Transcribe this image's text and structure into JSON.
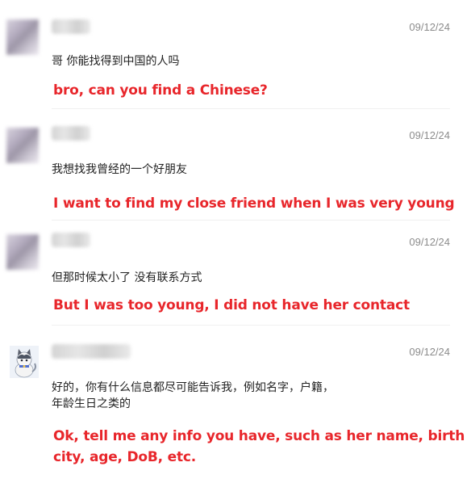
{
  "messages": [
    {
      "date": "09/12/24",
      "original": "哥 你能找得到中国的人吗",
      "translation": "bro, can you find a Chinese?"
    },
    {
      "date": "09/12/24",
      "original": "我想找我曾经的一个好朋友",
      "translation": "I want to find my close friend when I was very young"
    },
    {
      "date": "09/12/24",
      "original": "但那时候太小了 没有联系方式",
      "translation": "But I was too young, I did not have her contact"
    },
    {
      "date": "09/12/24",
      "original_line1": "好的，你有什么信息都尽可能告诉我，例如名字，户籍，",
      "original_line2": "年龄生日之类的",
      "translation_line1": "Ok, tell me any info you have, such as her name, birth",
      "translation_line2": "city, age, DoB, etc."
    }
  ]
}
